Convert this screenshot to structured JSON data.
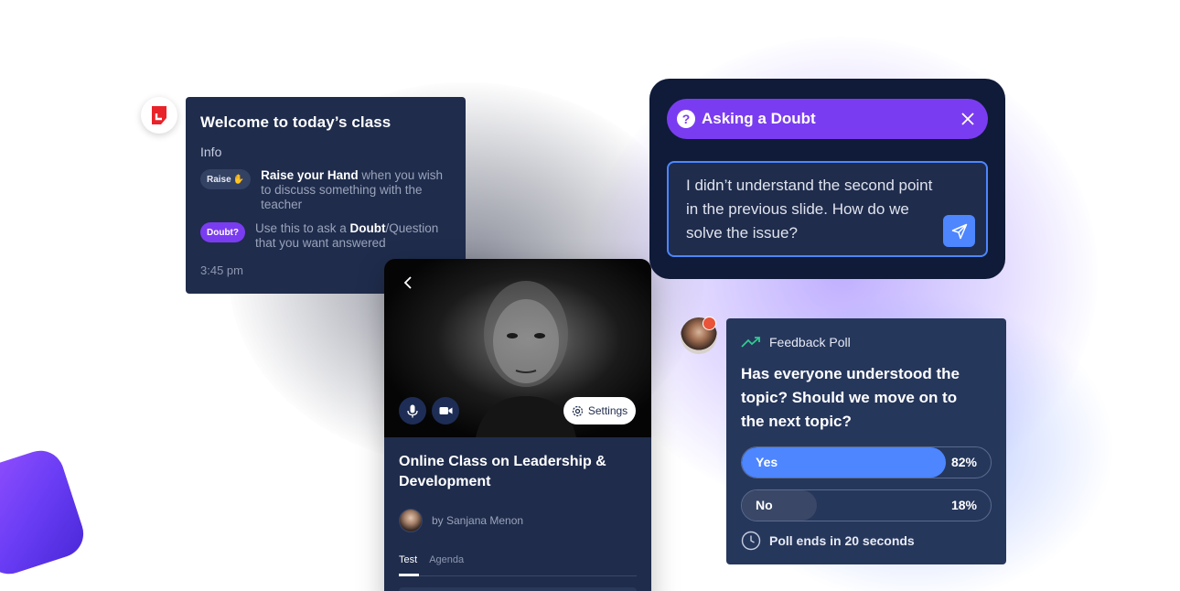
{
  "welcome": {
    "title": "Welcome to today’s class",
    "info_label": "Info",
    "raise_chip": "Raise",
    "raise_chip_emoji": "✋",
    "raise_bold": "Raise your Hand",
    "raise_text": " when you wish to discuss something with the teacher",
    "doubt_chip": "Doubt?",
    "doubt_pre": "Use this to ask a ",
    "doubt_bold": "Doubt",
    "doubt_post": "/Question that you want answered",
    "time": "3:45 pm"
  },
  "class_card": {
    "settings_label": "Settings",
    "title": "Online Class on Leadership & Development",
    "host": "by Sanjana Menon",
    "tabs": [
      "Test",
      "Agenda"
    ],
    "active_tab": "Test"
  },
  "doubt": {
    "title": "Asking a Doubt",
    "question_mark": "?",
    "message": "I didn’t understand the second point in the previous slide. How do we solve the issue?"
  },
  "poll": {
    "label": "Feedback Poll",
    "question": "Has everyone understood the topic? Should we move on to the next topic?",
    "options": [
      {
        "label": "Yes",
        "percent": "82%",
        "value": 0.82
      },
      {
        "label": "No",
        "percent": "18%",
        "value": 0.18
      }
    ],
    "footer": "Poll ends in 20 seconds"
  },
  "colors": {
    "card_navy": "#1f2c4c",
    "accent_purple": "#7a3cf0",
    "accent_blue": "#4d86ff",
    "trend_green": "#2ecc8f"
  }
}
